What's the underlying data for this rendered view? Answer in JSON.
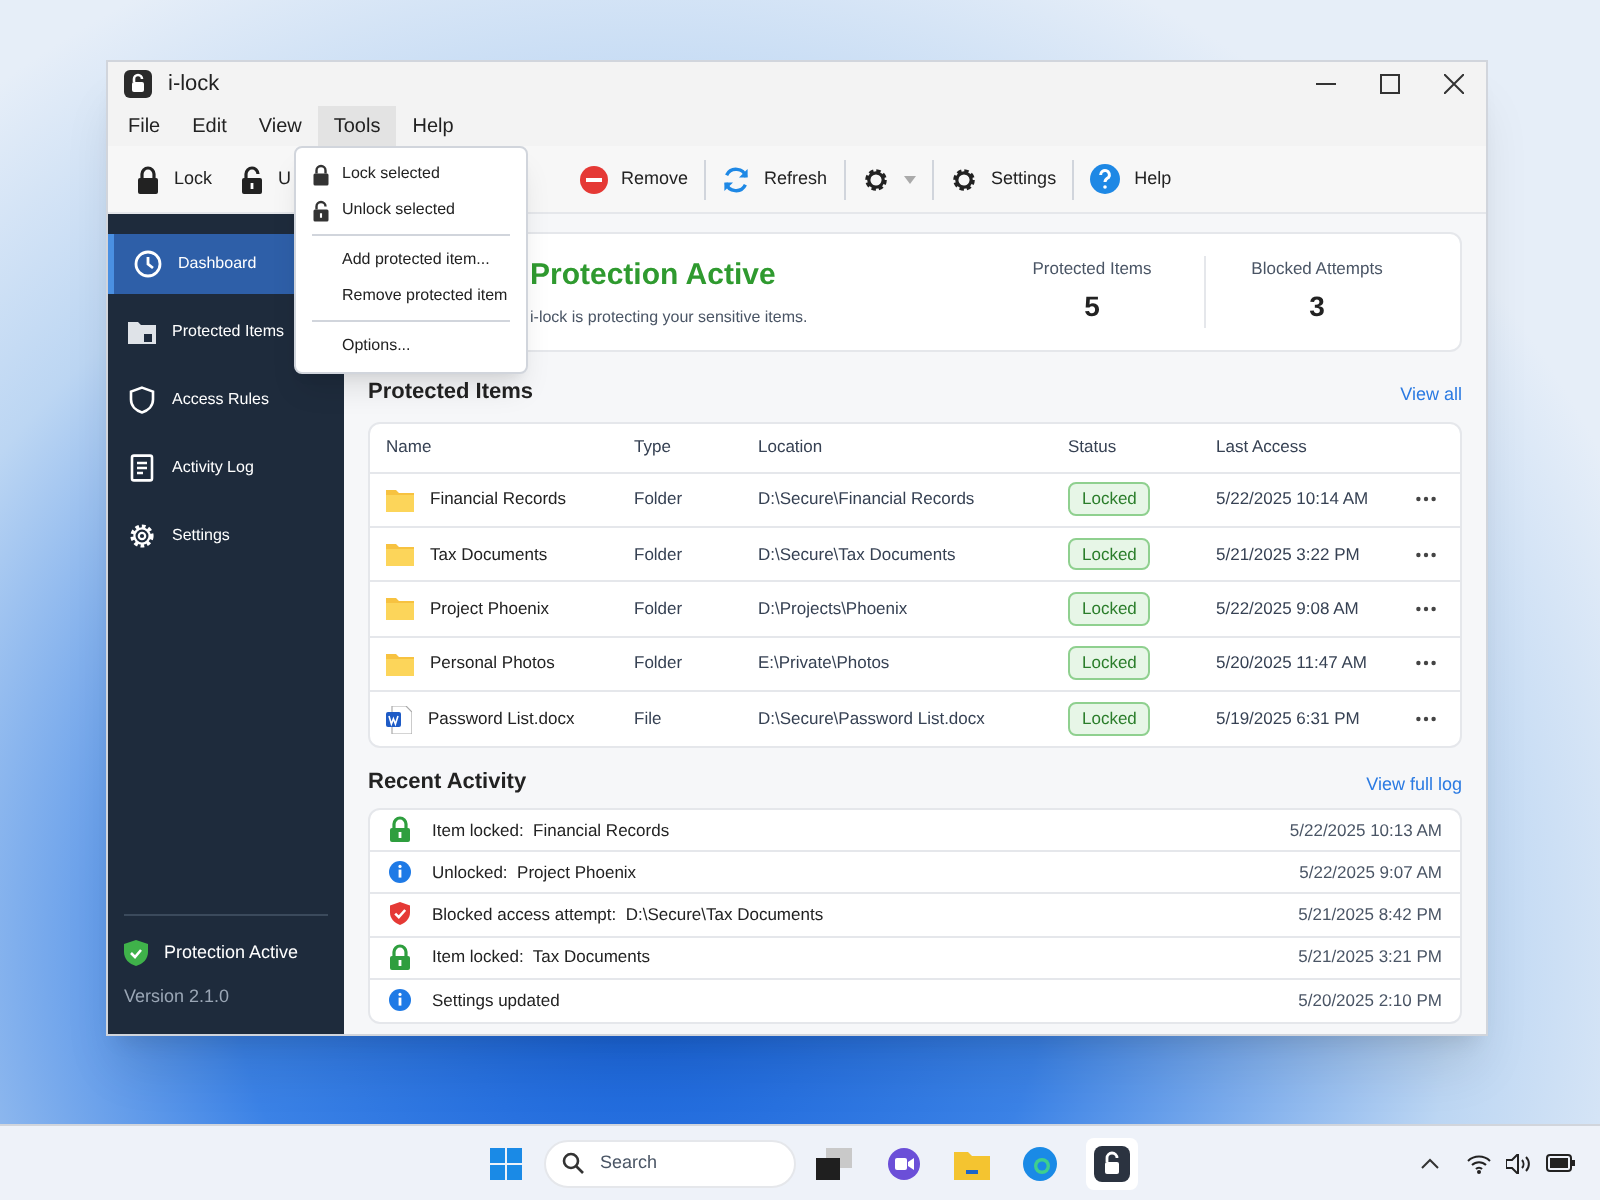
{
  "window": {
    "title": "i-lock"
  },
  "menu_bar": [
    {
      "label": "File",
      "selected": false
    },
    {
      "label": "Edit",
      "selected": false
    },
    {
      "label": "View",
      "selected": false
    },
    {
      "label": "Tools",
      "selected": true
    },
    {
      "label": "Help",
      "selected": false
    }
  ],
  "tools_menu": [
    {
      "kind": "lock",
      "label": "Lock selected"
    },
    {
      "kind": "unlock",
      "label": "Unlock selected"
    },
    {
      "kind": "separator"
    },
    {
      "kind": "plain",
      "label": "Add protected item..."
    },
    {
      "kind": "plain",
      "label": "Remove protected item"
    },
    {
      "kind": "separator"
    },
    {
      "kind": "plain",
      "label": "Options..."
    }
  ],
  "toolbar": [
    {
      "kind": "lock",
      "label": "Lock"
    },
    {
      "kind": "unlock",
      "label": "U"
    },
    {
      "kind": "remove",
      "label": "Remove"
    },
    {
      "kind": "refresh",
      "label": "Refresh"
    },
    {
      "kind": "gear-dropdown"
    },
    {
      "kind": "settings",
      "label": "Settings"
    },
    {
      "kind": "help",
      "label": "Help"
    }
  ],
  "sidebar": {
    "items": [
      {
        "kind": "clock",
        "label": "Dashboard",
        "selected": true
      },
      {
        "kind": "folder",
        "label": "Protected Items",
        "selected": false
      },
      {
        "kind": "shield",
        "label": "Access Rules",
        "selected": false
      },
      {
        "kind": "log",
        "label": "Activity Log",
        "selected": false
      },
      {
        "kind": "gear",
        "label": "Settings",
        "selected": false
      }
    ],
    "status": "Protection Active",
    "version": "Version 2.1.0"
  },
  "summary": {
    "title": "Protection Active",
    "subtitle": "i-lock is protecting your sensitive items.",
    "stats": [
      {
        "label": "Protected Items",
        "value": "5"
      },
      {
        "label": "Blocked Attempts",
        "value": "3"
      }
    ]
  },
  "protected_items": {
    "title": "Protected Items",
    "link": "View all",
    "columns": [
      "Name",
      "Type",
      "Location",
      "Status",
      "Last Access"
    ],
    "rows": [
      {
        "kind": "folder",
        "name": "Financial Records",
        "type": "Folder",
        "location": "D:\\Secure\\Financial Records",
        "status": "Locked",
        "last_access": "5/22/2025 10:14 AM"
      },
      {
        "kind": "folder",
        "name": "Tax Documents",
        "type": "Folder",
        "location": "D:\\Secure\\Tax Documents",
        "status": "Locked",
        "last_access": "5/21/2025 3:22 PM"
      },
      {
        "kind": "folder",
        "name": "Project Phoenix",
        "type": "Folder",
        "location": "D:\\Projects\\Phoenix",
        "status": "Locked",
        "last_access": "5/22/2025 9:08 AM"
      },
      {
        "kind": "folder",
        "name": "Personal Photos",
        "type": "Folder",
        "location": "E:\\Private\\Photos",
        "status": "Locked",
        "last_access": "5/20/2025 11:47 AM"
      },
      {
        "kind": "word",
        "name": "Password List.docx",
        "type": "File",
        "location": "D:\\Secure\\Password List.docx",
        "status": "Locked",
        "last_access": "5/19/2025 6:31 PM"
      }
    ]
  },
  "recent_activity": {
    "title": "Recent Activity",
    "link": "View full log",
    "rows": [
      {
        "kind": "locked",
        "text": "Item locked:  Financial Records",
        "time": "5/22/2025 10:13 AM"
      },
      {
        "kind": "info",
        "text": "Unlocked:  Project Phoenix",
        "time": "5/22/2025 9:07 AM"
      },
      {
        "kind": "blocked",
        "text": "Blocked access attempt:  D:\\Secure\\Tax Documents",
        "time": "5/21/2025 8:42 PM"
      },
      {
        "kind": "locked",
        "text": "Item locked:  Tax Documents",
        "time": "5/21/2025 3:21 PM"
      },
      {
        "kind": "info",
        "text": "Settings updated",
        "time": "5/20/2025 2:10 PM"
      }
    ]
  },
  "taskbar": {
    "search_placeholder": "Search"
  }
}
